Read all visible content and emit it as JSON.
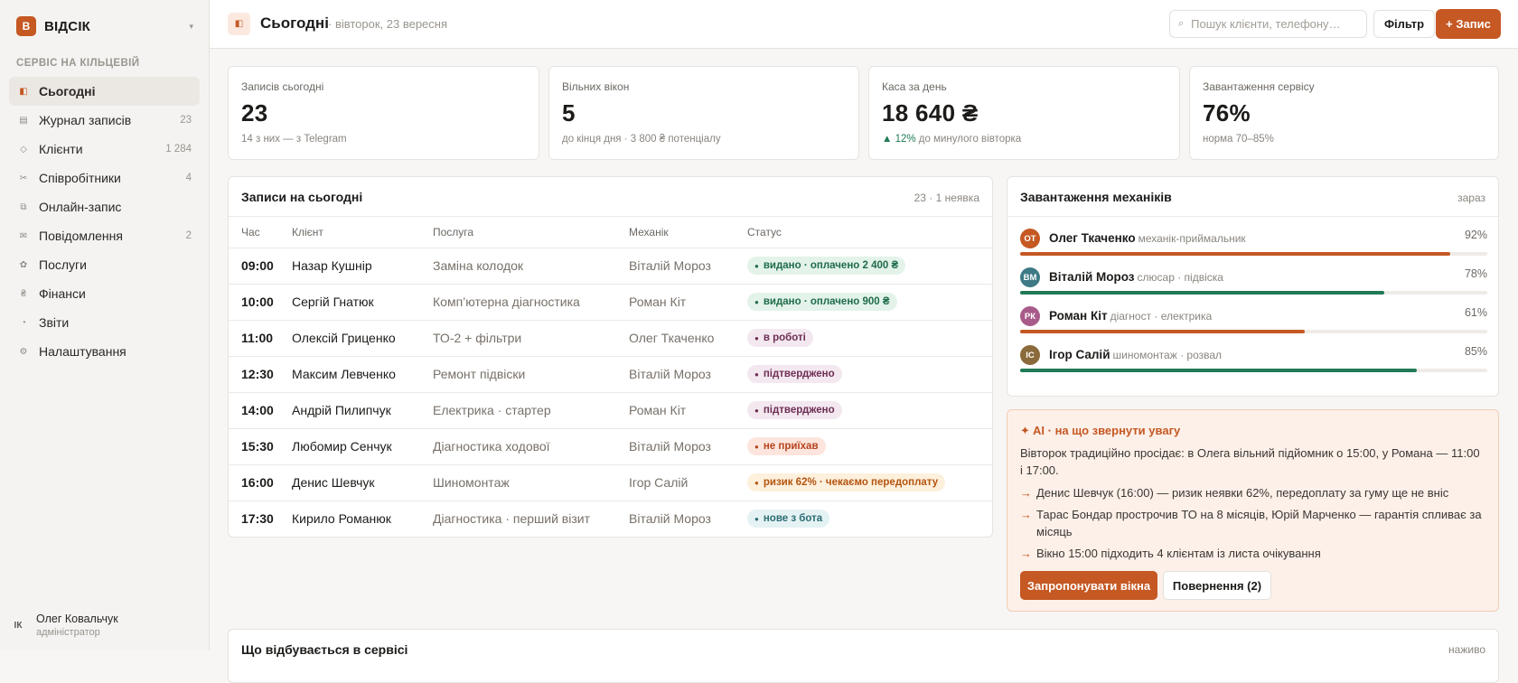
{
  "brand": {
    "logo": "В",
    "name": "ВІДСІК",
    "chevron": "▾"
  },
  "sidebar": {
    "section_label": "СЕРВІС НА КІЛЬЦЕВІЙ",
    "items": [
      {
        "label": "Сьогодні",
        "icon": "◧",
        "count": ""
      },
      {
        "label": "Журнал записів",
        "icon": "▤",
        "count": "23"
      },
      {
        "label": "Клієнти",
        "icon": "◇",
        "count": "1 284"
      },
      {
        "label": "Співробітники",
        "icon": "✂",
        "count": "4"
      },
      {
        "label": "Онлайн-запис",
        "icon": "⧉",
        "count": ""
      },
      {
        "label": "Повідомлення",
        "icon": "✉",
        "count": "2"
      },
      {
        "label": "Послуги",
        "icon": "✿",
        "count": ""
      },
      {
        "label": "Фінанси",
        "icon": "₴",
        "count": ""
      },
      {
        "label": "Звіти",
        "icon": "◔",
        "count": ""
      },
      {
        "label": "Налаштування",
        "icon": "⚙",
        "count": ""
      }
    ],
    "user": {
      "avatar": "ІК",
      "name": "Олег Ковальчук",
      "role": "адміністратор"
    }
  },
  "header": {
    "icon": "◧",
    "title": "Сьогодні",
    "date": "· вівторок, 23 вересня",
    "search_icon": "⌕",
    "search_placeholder": "Пошук клієнти, телефону…",
    "filter_label": "Фільтр",
    "new_label": "+ Запис"
  },
  "stats": [
    {
      "label": "Записів сьогодні",
      "value": "23",
      "sub_prefix": "",
      "sub": "14 з них — з Telegram"
    },
    {
      "label": "Вільних вікон",
      "value": "5",
      "sub_prefix": "",
      "sub": "до кінця дня · 3 800 ₴ потенціалу"
    },
    {
      "label": "Каса за день",
      "value": "18 640 ₴",
      "sub_prefix": "▲ 12%",
      "sub": " до минулого вівторка"
    },
    {
      "label": "Завантаження сервісу",
      "value": "76%",
      "sub_prefix": "",
      "sub": "норма 70–85%"
    }
  ],
  "appointments": {
    "title": "Записи на сьогодні",
    "meta": "23 · 1 неявка",
    "columns": [
      "Час",
      "Клієнт",
      "Послуга",
      "Механік",
      "Статус"
    ],
    "rows": [
      {
        "time": "09:00",
        "client": "Назар Кушнір",
        "service": "Заміна колодок",
        "mechanic": "Віталій Мороз",
        "status": "видано · оплачено 2 400 ₴",
        "status_type": "done"
      },
      {
        "time": "10:00",
        "client": "Сергій Гнатюк",
        "service": "Комп’ютерна діагностика",
        "mechanic": "Роман Кіт",
        "status": "видано · оплачено 900 ₴",
        "status_type": "done"
      },
      {
        "time": "11:00",
        "client": "Олексій Гриценко",
        "service": "ТО-2 + фільтри",
        "mechanic": "Олег Ткаченко",
        "status": "в роботі",
        "status_type": "progress"
      },
      {
        "time": "12:30",
        "client": "Максим Левченко",
        "service": "Ремонт підвіски",
        "mechanic": "Віталій Мороз",
        "status": "підтверджено",
        "status_type": "confirmed"
      },
      {
        "time": "14:00",
        "client": "Андрій Пилипчук",
        "service": "Електрика · стартер",
        "mechanic": "Роман Кіт",
        "status": "підтверджено",
        "status_type": "confirmed"
      },
      {
        "time": "15:30",
        "client": "Любомир Сенчук",
        "service": "Діагностика ходової",
        "mechanic": "Віталій Мороз",
        "status": "не приїхав",
        "status_type": "noshow"
      },
      {
        "time": "16:00",
        "client": "Денис Шевчук",
        "service": "Шиномонтаж",
        "mechanic": "Ігор Салій",
        "status": "ризик 62% · чекаємо передоплату",
        "status_type": "risk"
      },
      {
        "time": "17:30",
        "client": "Кирило Романюк",
        "service": "Діагностика · перший візит",
        "mechanic": "Віталій Мороз",
        "status": "нове з бота",
        "status_type": "new"
      }
    ]
  },
  "mechanics": {
    "title": "Завантаження механіків",
    "meta": "зараз",
    "items": [
      {
        "initials": "ОТ",
        "name": "Олег Ткаченко",
        "role": "механік-приймальник",
        "load": 92,
        "load_label": "92%",
        "color": "#c55823"
      },
      {
        "initials": "ВМ",
        "name": "Віталій Мороз",
        "role": "слюсар · підвіска",
        "load": 78,
        "load_label": "78%",
        "color": "#1f7a55"
      },
      {
        "initials": "РК",
        "name": "Роман Кіт",
        "role": "діагност · електрика",
        "load": 61,
        "load_label": "61%",
        "color": "#c55823"
      },
      {
        "initials": "ІС",
        "name": "Ігор Салій",
        "role": "шиномонтаж · розвал",
        "load": 85,
        "load_label": "85%",
        "color": "#1f7a55"
      }
    ]
  },
  "ai": {
    "title": "✦ AI · на що звернути увагу",
    "intro": "Вівторок традиційно просідає: в Олега вільний підйомник о 15:00, у Романа — 11:00 і 17:00.",
    "arrow": "→",
    "items": [
      "Денис Шевчук (16:00) — ризик неявки 62%, передоплату за гуму ще не вніс",
      "Тарас Бондар прострочив ТО на 8 місяців, Юрій Марченко — гарантія спливає за місяць",
      "Вікно 15:00 підходить 4 клієнтам із листа очікування"
    ],
    "offer_label": "Запропонувати вікна",
    "returns_label": "Повернення (2)"
  },
  "activity": {
    "title": "Що відбувається в сервісі",
    "meta": "наживо"
  },
  "colors": {
    "accent": "#c55823",
    "success": "#1f7a55",
    "ai_bg": "#fdf0e9",
    "mech_avatars": [
      "#c55823",
      "#3d7a86",
      "#a85b8a",
      "#8a6a3a"
    ]
  }
}
